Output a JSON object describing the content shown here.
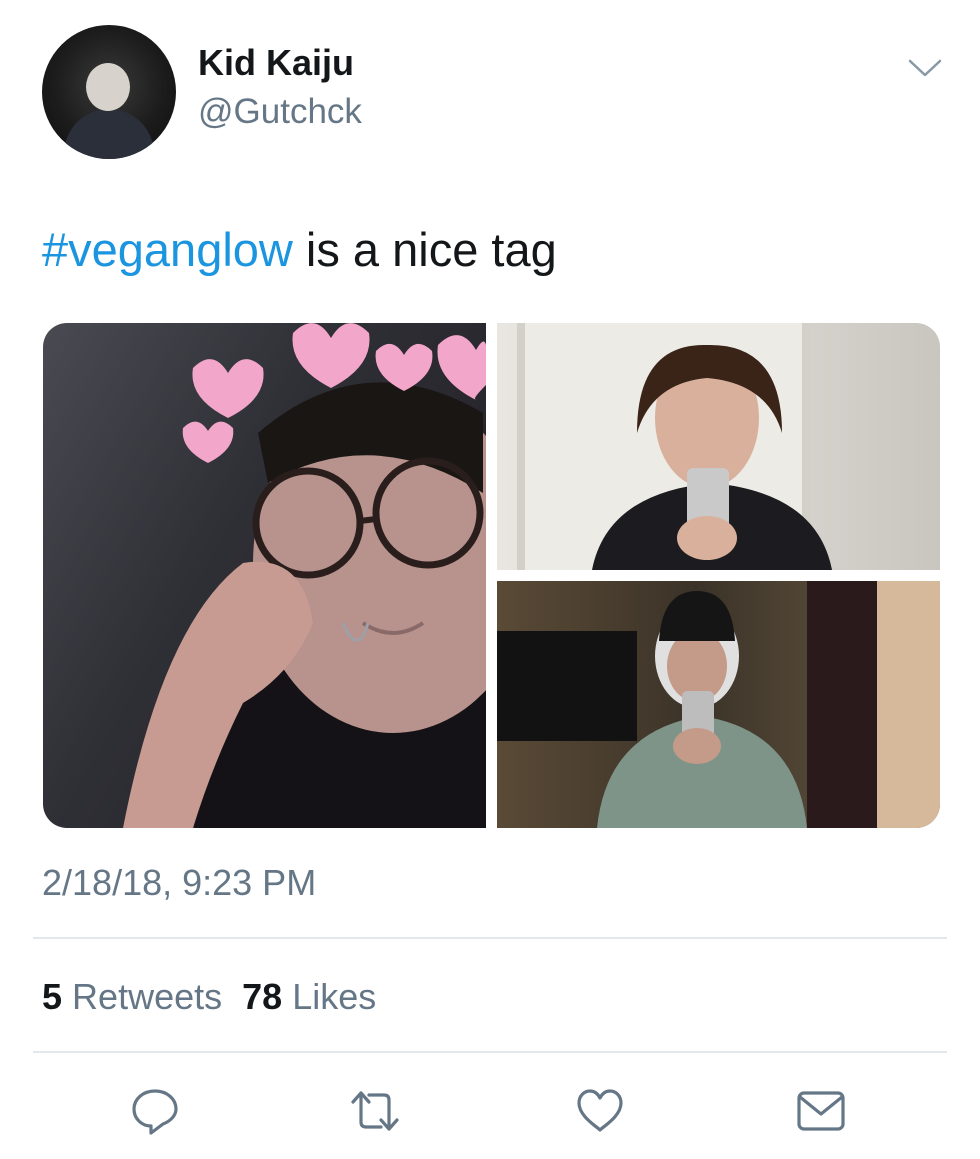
{
  "tweet": {
    "author": {
      "display_name": "Kid Kaiju",
      "handle": "@Gutchck"
    },
    "text": {
      "hashtag": "#veganglow",
      "rest": " is a nice tag"
    },
    "media": {
      "photo_count": 3
    },
    "timestamp": "2/18/18, 9:23 PM",
    "stats": {
      "retweets_count": "5",
      "retweets_label": "Retweets",
      "likes_count": "78",
      "likes_label": "Likes"
    },
    "actions": [
      {
        "name": "reply",
        "icon": "reply-icon"
      },
      {
        "name": "retweet",
        "icon": "retweet-icon"
      },
      {
        "name": "like",
        "icon": "heart-icon"
      },
      {
        "name": "direct-message",
        "icon": "envelope-icon"
      }
    ]
  },
  "colors": {
    "hashtag": "#1b95e0",
    "secondary_text": "#657786",
    "primary_text": "#14171a",
    "divider": "#e1e8ed",
    "icon": "#657786"
  }
}
